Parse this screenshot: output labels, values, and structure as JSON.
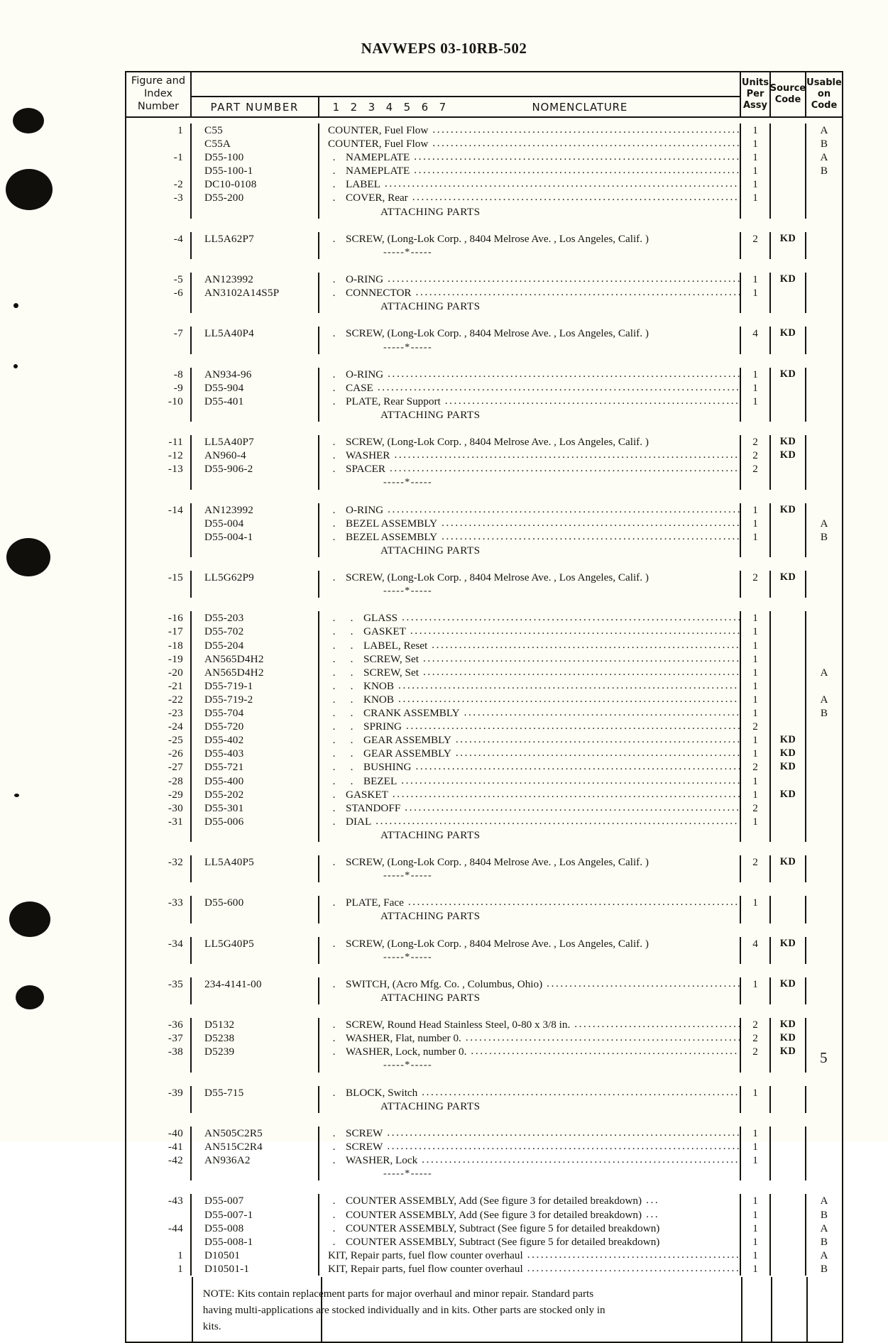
{
  "document": {
    "title": "NAVWEPS 03-10RB-502",
    "page_number": "5"
  },
  "table": {
    "headers": {
      "figure_index_number": "Figure and\nIndex\nNumber",
      "figure_line1": "Figure and",
      "figure_line2": "Index",
      "figure_line3": "Number",
      "part_number": "PART  NUMBER",
      "level_numbers": [
        "1",
        "2",
        "3",
        "4",
        "5",
        "6",
        "7"
      ],
      "nomenclature": "NOMENCLATURE",
      "units_per_assy_line1": "Units",
      "units_per_assy_line2": "Per",
      "units_per_assy_line3": "Assy",
      "source_code_line1": "Source",
      "source_code_line2": "Code",
      "usable_on_code_line1": "Usable",
      "usable_on_code_line2": "on",
      "usable_on_code_line3": "Code"
    },
    "rows": [
      {
        "index": "1",
        "part_number": "C55",
        "indent": 0,
        "text": "COUNTER, Fuel Flow",
        "leader": true,
        "units": "1",
        "source": "",
        "usable": "A"
      },
      {
        "index": "",
        "part_number": "C55A",
        "indent": 0,
        "text": "COUNTER, Fuel Flow",
        "leader": true,
        "units": "1",
        "source": "",
        "usable": "B"
      },
      {
        "index": "-1",
        "part_number": "D55-100",
        "indent": 1,
        "text": "NAMEPLATE",
        "leader": true,
        "units": "1",
        "source": "",
        "usable": "A"
      },
      {
        "index": "",
        "part_number": "D55-100-1",
        "indent": 1,
        "text": "NAMEPLATE",
        "leader": true,
        "units": "1",
        "source": "",
        "usable": "B"
      },
      {
        "index": "-2",
        "part_number": "DC10-0108",
        "indent": 1,
        "text": "LABEL",
        "leader": true,
        "units": "1",
        "source": "",
        "usable": ""
      },
      {
        "index": "-3",
        "part_number": "D55-200",
        "indent": 1,
        "text": "COVER, Rear",
        "leader": true,
        "units": "1",
        "source": "",
        "usable": ""
      },
      {
        "type": "attaching",
        "text": "ATTACHING PARTS"
      },
      {
        "type": "gap"
      },
      {
        "index": "-4",
        "part_number": "LL5A62P7",
        "indent": 1,
        "text": "SCREW, (Long-Lok Corp. , 8404 Melrose Ave. , Los Angeles, Calif. )",
        "leader": false,
        "units": "2",
        "source": "KD",
        "usable": ""
      },
      {
        "type": "stars",
        "text": "-----*-----"
      },
      {
        "type": "gap"
      },
      {
        "index": "-5",
        "part_number": "AN123992",
        "indent": 1,
        "text": "O-RING",
        "leader": true,
        "units": "1",
        "source": "KD",
        "usable": ""
      },
      {
        "index": "-6",
        "part_number": "AN3102A14S5P",
        "indent": 1,
        "text": "CONNECTOR",
        "leader": true,
        "units": "1",
        "source": "",
        "usable": ""
      },
      {
        "type": "attaching",
        "text": "ATTACHING PARTS"
      },
      {
        "type": "gap"
      },
      {
        "index": "-7",
        "part_number": "LL5A40P4",
        "indent": 1,
        "text": "SCREW, (Long-Lok Corp. , 8404 Melrose Ave. , Los Angeles, Calif. )",
        "leader": false,
        "units": "4",
        "source": "KD",
        "usable": ""
      },
      {
        "type": "stars",
        "text": "-----*-----"
      },
      {
        "type": "gap"
      },
      {
        "index": "-8",
        "part_number": "AN934-96",
        "indent": 1,
        "text": "O-RING",
        "leader": true,
        "units": "1",
        "source": "KD",
        "usable": ""
      },
      {
        "index": "-9",
        "part_number": "D55-904",
        "indent": 1,
        "text": "CASE",
        "leader": true,
        "units": "1",
        "source": "",
        "usable": ""
      },
      {
        "index": "-10",
        "part_number": "D55-401",
        "indent": 1,
        "text": "PLATE, Rear Support",
        "leader": true,
        "units": "1",
        "source": "",
        "usable": ""
      },
      {
        "type": "attaching",
        "text": "ATTACHING PARTS"
      },
      {
        "type": "gap"
      },
      {
        "index": "-11",
        "part_number": "LL5A40P7",
        "indent": 1,
        "text": "SCREW, (Long-Lok Corp. , 8404 Melrose Ave. , Los Angeles, Calif. )",
        "leader": false,
        "units": "2",
        "source": "KD",
        "usable": ""
      },
      {
        "index": "-12",
        "part_number": "AN960-4",
        "indent": 1,
        "text": "WASHER",
        "leader": true,
        "units": "2",
        "source": "KD",
        "usable": ""
      },
      {
        "index": "-13",
        "part_number": "D55-906-2",
        "indent": 1,
        "text": "SPACER",
        "leader": true,
        "units": "2",
        "source": "",
        "usable": ""
      },
      {
        "type": "stars",
        "text": "-----*-----"
      },
      {
        "type": "gap"
      },
      {
        "index": "-14",
        "part_number": "AN123992",
        "indent": 1,
        "text": "O-RING",
        "leader": true,
        "units": "1",
        "source": "KD",
        "usable": ""
      },
      {
        "index": "",
        "part_number": "D55-004",
        "indent": 1,
        "text": "BEZEL ASSEMBLY",
        "leader": true,
        "units": "1",
        "source": "",
        "usable": "A"
      },
      {
        "index": "",
        "part_number": "D55-004-1",
        "indent": 1,
        "text": "BEZEL ASSEMBLY",
        "leader": true,
        "units": "1",
        "source": "",
        "usable": "B"
      },
      {
        "type": "attaching",
        "text": "ATTACHING PARTS"
      },
      {
        "type": "gap"
      },
      {
        "index": "-15",
        "part_number": "LL5G62P9",
        "indent": 1,
        "text": "SCREW, (Long-Lok Corp. , 8404 Melrose Ave. , Los Angeles, Calif. )",
        "leader": false,
        "units": "2",
        "source": "KD",
        "usable": ""
      },
      {
        "type": "stars",
        "text": "-----*-----"
      },
      {
        "type": "gap"
      },
      {
        "index": "-16",
        "part_number": "D55-203",
        "indent": 2,
        "text": "GLASS",
        "leader": true,
        "units": "1",
        "source": "",
        "usable": ""
      },
      {
        "index": "-17",
        "part_number": "D55-702",
        "indent": 2,
        "text": "GASKET",
        "leader": true,
        "units": "1",
        "source": "",
        "usable": ""
      },
      {
        "index": "-18",
        "part_number": "D55-204",
        "indent": 2,
        "text": "LABEL, Reset",
        "leader": true,
        "units": "1",
        "source": "",
        "usable": ""
      },
      {
        "index": "-19",
        "part_number": "AN565D4H2",
        "indent": 2,
        "text": "SCREW, Set",
        "leader": true,
        "units": "1",
        "source": "",
        "usable": ""
      },
      {
        "index": "-20",
        "part_number": "AN565D4H2",
        "indent": 2,
        "text": "SCREW, Set",
        "leader": true,
        "units": "1",
        "source": "",
        "usable": "A"
      },
      {
        "index": "-21",
        "part_number": "D55-719-1",
        "indent": 2,
        "text": "KNOB",
        "leader": true,
        "units": "1",
        "source": "",
        "usable": ""
      },
      {
        "index": "-22",
        "part_number": "D55-719-2",
        "indent": 2,
        "text": "KNOB",
        "leader": true,
        "units": "1",
        "source": "",
        "usable": "A"
      },
      {
        "index": "-23",
        "part_number": "D55-704",
        "indent": 2,
        "text": "CRANK ASSEMBLY",
        "leader": true,
        "units": "1",
        "source": "",
        "usable": "B"
      },
      {
        "index": "-24",
        "part_number": "D55-720",
        "indent": 2,
        "text": "SPRING",
        "leader": true,
        "units": "2",
        "source": "",
        "usable": ""
      },
      {
        "index": "-25",
        "part_number": "D55-402",
        "indent": 2,
        "text": "GEAR ASSEMBLY",
        "leader": true,
        "units": "1",
        "source": "KD",
        "usable": ""
      },
      {
        "index": "-26",
        "part_number": "D55-403",
        "indent": 2,
        "text": "GEAR ASSEMBLY",
        "leader": true,
        "units": "1",
        "source": "KD",
        "usable": ""
      },
      {
        "index": "-27",
        "part_number": "D55-721",
        "indent": 2,
        "text": "BUSHING",
        "leader": true,
        "units": "2",
        "source": "KD",
        "usable": ""
      },
      {
        "index": "-28",
        "part_number": "D55-400",
        "indent": 2,
        "text": "BEZEL",
        "leader": true,
        "units": "1",
        "source": "",
        "usable": ""
      },
      {
        "index": "-29",
        "part_number": "D55-202",
        "indent": 1,
        "text": "GASKET",
        "leader": true,
        "units": "1",
        "source": "KD",
        "usable": ""
      },
      {
        "index": "-30",
        "part_number": "D55-301",
        "indent": 1,
        "text": "STANDOFF",
        "leader": true,
        "units": "2",
        "source": "",
        "usable": ""
      },
      {
        "index": "-31",
        "part_number": "D55-006",
        "indent": 1,
        "text": "DIAL",
        "leader": true,
        "units": "1",
        "source": "",
        "usable": ""
      },
      {
        "type": "attaching",
        "text": "ATTACHING PARTS"
      },
      {
        "type": "gap"
      },
      {
        "index": "-32",
        "part_number": "LL5A40P5",
        "indent": 1,
        "text": "SCREW, (Long-Lok Corp. , 8404 Melrose Ave. , Los Angeles, Calif. )",
        "leader": false,
        "units": "2",
        "source": "KD",
        "usable": ""
      },
      {
        "type": "stars",
        "text": "-----*-----"
      },
      {
        "type": "gap"
      },
      {
        "index": "-33",
        "part_number": "D55-600",
        "indent": 1,
        "text": "PLATE, Face",
        "leader": true,
        "units": "1",
        "source": "",
        "usable": ""
      },
      {
        "type": "attaching",
        "text": "ATTACHING PARTS"
      },
      {
        "type": "gap"
      },
      {
        "index": "-34",
        "part_number": "LL5G40P5",
        "indent": 1,
        "text": "SCREW, (Long-Lok Corp. , 8404 Melrose Ave. , Los Angeles, Calif. )",
        "leader": false,
        "units": "4",
        "source": "KD",
        "usable": ""
      },
      {
        "type": "stars",
        "text": "-----*-----"
      },
      {
        "type": "gap"
      },
      {
        "index": "-35",
        "part_number": "234-4141-00",
        "indent": 1,
        "text": "SWITCH, (Acro Mfg. Co. , Columbus, Ohio)",
        "leader": true,
        "units": "1",
        "source": "KD",
        "usable": ""
      },
      {
        "type": "attaching",
        "text": "ATTACHING PARTS"
      },
      {
        "type": "gap"
      },
      {
        "index": "-36",
        "part_number": "D5132",
        "indent": 1,
        "text": "SCREW, Round Head Stainless Steel, 0-80 x 3/8 in.",
        "leader": true,
        "units": "2",
        "source": "KD",
        "usable": ""
      },
      {
        "index": "-37",
        "part_number": "D5238",
        "indent": 1,
        "text": "WASHER, Flat, number 0.",
        "leader": true,
        "units": "2",
        "source": "KD",
        "usable": ""
      },
      {
        "index": "-38",
        "part_number": "D5239",
        "indent": 1,
        "text": "WASHER, Lock, number 0.",
        "leader": true,
        "units": "2",
        "source": "KD",
        "usable": ""
      },
      {
        "type": "stars",
        "text": "-----*-----"
      },
      {
        "type": "gap"
      },
      {
        "index": "-39",
        "part_number": "D55-715",
        "indent": 1,
        "text": "BLOCK, Switch",
        "leader": true,
        "units": "1",
        "source": "",
        "usable": ""
      },
      {
        "type": "attaching",
        "text": "ATTACHING PARTS"
      },
      {
        "type": "gap"
      },
      {
        "index": "-40",
        "part_number": "AN505C2R5",
        "indent": 1,
        "text": "SCREW",
        "leader": true,
        "units": "1",
        "source": "",
        "usable": ""
      },
      {
        "index": "-41",
        "part_number": "AN515C2R4",
        "indent": 1,
        "text": "SCREW",
        "leader": true,
        "units": "1",
        "source": "",
        "usable": ""
      },
      {
        "index": "-42",
        "part_number": "AN936A2",
        "indent": 1,
        "text": "WASHER, Lock",
        "leader": true,
        "units": "1",
        "source": "",
        "usable": ""
      },
      {
        "type": "stars",
        "text": "-----*-----"
      },
      {
        "type": "gap"
      },
      {
        "index": "-43",
        "part_number": "D55-007",
        "indent": 1,
        "text": "COUNTER ASSEMBLY, Add (See figure 3 for detailed breakdown)",
        "leader": "short",
        "units": "1",
        "source": "",
        "usable": "A"
      },
      {
        "index": "",
        "part_number": "D55-007-1",
        "indent": 1,
        "text": "COUNTER ASSEMBLY, Add (See figure 3 for detailed breakdown)",
        "leader": "short",
        "units": "1",
        "source": "",
        "usable": "B"
      },
      {
        "index": "-44",
        "part_number": "D55-008",
        "indent": 1,
        "text": "COUNTER ASSEMBLY, Subtract (See figure 5 for detailed breakdown)",
        "leader": false,
        "units": "1",
        "source": "",
        "usable": "A"
      },
      {
        "index": "",
        "part_number": "D55-008-1",
        "indent": 1,
        "text": "COUNTER ASSEMBLY, Subtract (See figure 5 for detailed breakdown)",
        "leader": false,
        "units": "1",
        "source": "",
        "usable": "B"
      },
      {
        "index": "1",
        "part_number": "D10501",
        "indent": 0,
        "text": "KIT, Repair parts, fuel flow counter overhaul",
        "leader": true,
        "units": "1",
        "source": "",
        "usable": "A"
      },
      {
        "index": "1",
        "part_number": "D10501-1",
        "indent": 0,
        "text": "KIT, Repair parts, fuel flow counter overhaul",
        "leader": true,
        "units": "1",
        "source": "",
        "usable": "B"
      }
    ],
    "note": {
      "line1": "NOTE:  Kits contain replacement parts for major overhaul and minor repair.  Standard parts",
      "line2": "having multi-applications are stocked individually and in kits.  Other parts are stocked only in",
      "line3": "kits."
    }
  }
}
